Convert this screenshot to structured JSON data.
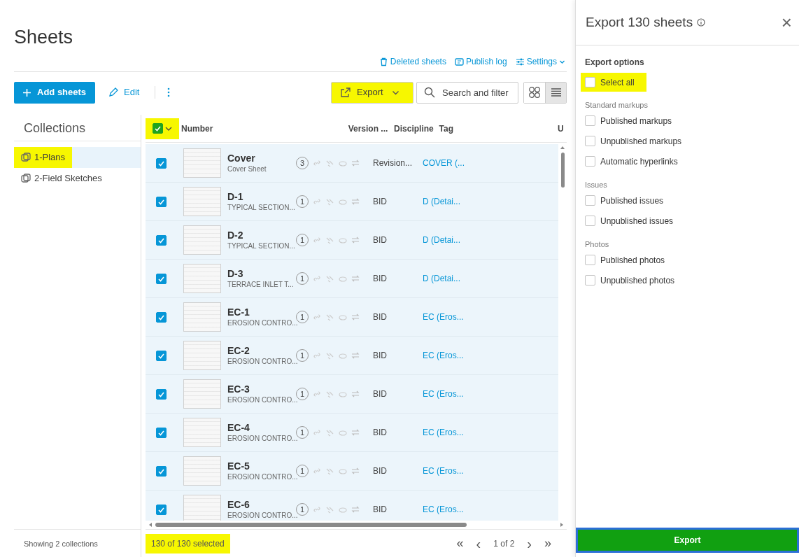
{
  "page_title": "Sheets",
  "top_links": [
    {
      "kind": "trash",
      "label": "Deleted sheets"
    },
    {
      "kind": "log",
      "label": "Publish log"
    },
    {
      "kind": "settings",
      "label": "Settings"
    }
  ],
  "toolbar": {
    "add_button": "Add sheets",
    "edit_button": "Edit",
    "export_button": {
      "label": "Export",
      "highlighted": true
    },
    "search": {
      "placeholder": "Search and filter"
    },
    "views": [
      {
        "kind": "grid",
        "selected": false
      },
      {
        "kind": "list",
        "selected": true
      }
    ]
  },
  "collections": {
    "title": "Collections",
    "items": [
      {
        "label": "1-Plans",
        "selected": true,
        "highlighted": true
      },
      {
        "label": "2-Field Sketches",
        "selected": false,
        "highlighted": false
      }
    ],
    "footer": "Showing 2 collections"
  },
  "table": {
    "select_all": {
      "checked": true,
      "highlighted": true
    },
    "columns": [
      "Number",
      "Version ...",
      "Discipline",
      "Tag",
      "U"
    ],
    "rows": [
      {
        "checked": true,
        "number": "Cover",
        "title": "Cover Sheet",
        "count": "3",
        "version": "Revision...",
        "discipline": "COVER (..."
      },
      {
        "checked": true,
        "number": "D-1",
        "title": "TYPICAL SECTION...",
        "count": "1",
        "version": "BID",
        "discipline": "D (Detai..."
      },
      {
        "checked": true,
        "number": "D-2",
        "title": "TYPICAL SECTION...",
        "count": "1",
        "version": "BID",
        "discipline": "D (Detai..."
      },
      {
        "checked": true,
        "number": "D-3",
        "title": "TERRACE INLET T...",
        "count": "1",
        "version": "BID",
        "discipline": "D (Detai..."
      },
      {
        "checked": true,
        "number": "EC-1",
        "title": "EROSION CONTRO...",
        "count": "1",
        "version": "BID",
        "discipline": "EC (Eros..."
      },
      {
        "checked": true,
        "number": "EC-2",
        "title": "EROSION CONTRO...",
        "count": "1",
        "version": "BID",
        "discipline": "EC (Eros..."
      },
      {
        "checked": true,
        "number": "EC-3",
        "title": "EROSION CONTRO...",
        "count": "1",
        "version": "BID",
        "discipline": "EC (Eros..."
      },
      {
        "checked": true,
        "number": "EC-4",
        "title": "EROSION CONTRO...",
        "count": "1",
        "version": "BID",
        "discipline": "EC (Eros..."
      },
      {
        "checked": true,
        "number": "EC-5",
        "title": "EROSION CONTRO...",
        "count": "1",
        "version": "BID",
        "discipline": "EC (Eros..."
      },
      {
        "checked": true,
        "number": "EC-6",
        "title": "EROSION CONTRO...",
        "count": "1",
        "version": "BID",
        "discipline": "EC (Eros..."
      }
    ],
    "selection_count": {
      "label": "130 of 130 selected",
      "highlighted": true
    },
    "pagination": {
      "first": "«",
      "prev": "‹",
      "page": "1 of 2",
      "next": "›",
      "last": "»"
    }
  },
  "export_panel": {
    "title": "Export 130 sheets",
    "close": "×",
    "section_title": "Export options",
    "select_all": {
      "label": "Select all",
      "checked": false,
      "highlighted": true
    },
    "groups": [
      {
        "title": "Standard markups",
        "options": [
          {
            "label": "Published markups",
            "checked": false
          },
          {
            "label": "Unpublished markups",
            "checked": false
          },
          {
            "label": "Automatic hyperlinks",
            "checked": false
          }
        ]
      },
      {
        "title": "Issues",
        "options": [
          {
            "label": "Published issues",
            "checked": false
          },
          {
            "label": "Unpublished issues",
            "checked": false
          }
        ]
      },
      {
        "title": "Photos",
        "options": [
          {
            "label": "Published photos",
            "checked": false
          },
          {
            "label": "Unpublished photos",
            "checked": false
          }
        ]
      }
    ],
    "export_button": "Export"
  }
}
